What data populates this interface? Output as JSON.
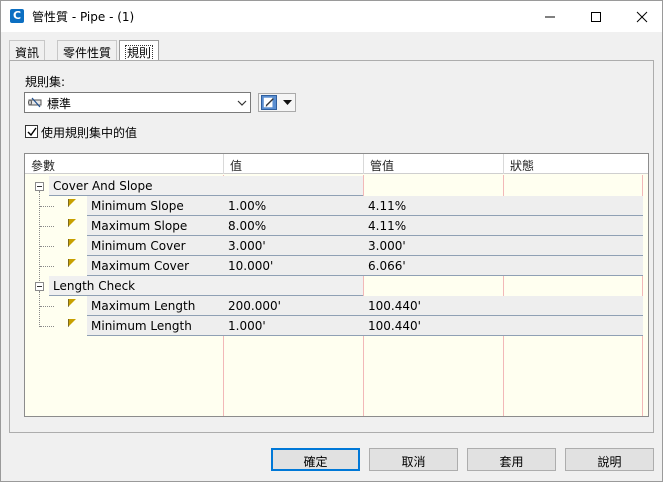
{
  "window": {
    "title": "管性質 - Pipe - (1)",
    "app_icon_letter": "C",
    "controls": {
      "minimize": "minimize-icon",
      "maximize": "maximize-icon",
      "close": "close-icon"
    }
  },
  "tabs": [
    {
      "label": "資訊",
      "active": false
    },
    {
      "label": "零件性質",
      "active": false
    },
    {
      "label": "規則",
      "active": true
    }
  ],
  "ruleset": {
    "label": "規則集:",
    "selected": "標準",
    "use_values_label": "使用規則集中的值",
    "use_values_checked": true
  },
  "grid": {
    "headers": [
      "參數",
      "值",
      "管值",
      "狀態"
    ],
    "groups": [
      {
        "name": "Cover And Slope",
        "rows": [
          {
            "param": "Minimum Slope",
            "value": "1.00%",
            "pipe_value": "4.11%",
            "status": ""
          },
          {
            "param": "Maximum Slope",
            "value": "8.00%",
            "pipe_value": "4.11%",
            "status": ""
          },
          {
            "param": "Minimum Cover",
            "value": "3.000'",
            "pipe_value": "3.000'",
            "status": ""
          },
          {
            "param": "Maximum Cover",
            "value": "10.000'",
            "pipe_value": "6.066'",
            "status": ""
          }
        ]
      },
      {
        "name": "Length Check",
        "rows": [
          {
            "param": "Maximum Length",
            "value": "200.000'",
            "pipe_value": "100.440'",
            "status": ""
          },
          {
            "param": "Minimum Length",
            "value": "1.000'",
            "pipe_value": "100.440'",
            "status": ""
          }
        ]
      }
    ]
  },
  "buttons": {
    "ok": "確定",
    "cancel": "取消",
    "apply": "套用",
    "help": "說明"
  },
  "colors": {
    "accent": "#0078d7",
    "grid_background": "#fffff0",
    "flag": "#c8a000"
  }
}
